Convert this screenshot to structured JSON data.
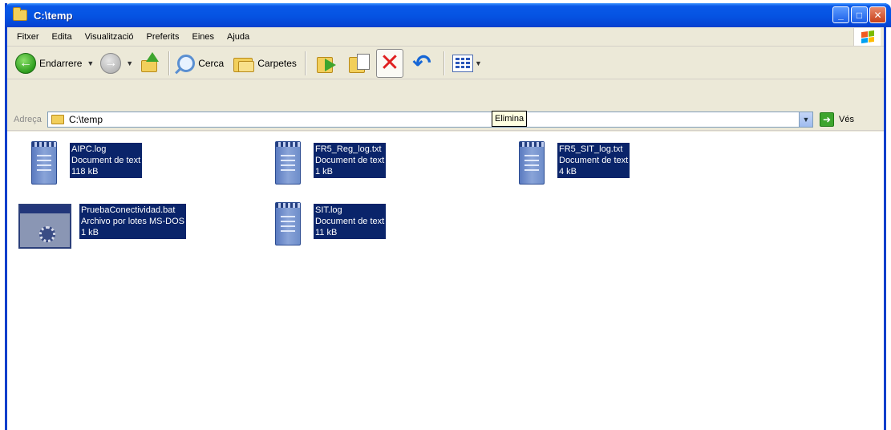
{
  "window": {
    "title": "C:\\temp"
  },
  "title_buttons": {
    "minimize": "_",
    "maximize": "□",
    "close": "✕"
  },
  "menu": {
    "items": [
      "Fitxer",
      "Edita",
      "Visualització",
      "Preferits",
      "Eines",
      "Ajuda"
    ]
  },
  "toolbar": {
    "back_label": "Endarrere",
    "search_label": "Cerca",
    "folders_label": "Carpetes"
  },
  "tooltip": {
    "text": "Elimina"
  },
  "address": {
    "label": "Adreça",
    "value": "C:\\temp",
    "go_label": "Vés"
  },
  "files": [
    {
      "name": "AIPC.log",
      "type": "Document de text",
      "size": "118 kB",
      "icon": "text-document-icon"
    },
    {
      "name": "FR5_Reg_log.txt",
      "type": "Document de text",
      "size": "1 kB",
      "icon": "text-document-icon"
    },
    {
      "name": "FR5_SIT_log.txt",
      "type": "Document de text",
      "size": "4 kB",
      "icon": "text-document-icon"
    },
    {
      "name": "PruebaConectividad.bat",
      "type": "Archivo por lotes MS-DOS",
      "size": "1 kB",
      "icon": "batch-file-icon"
    },
    {
      "name": "SIT.log",
      "type": "Document de text",
      "size": "11 kB",
      "icon": "text-document-icon"
    }
  ],
  "colors": {
    "titlebar": "#0554e3",
    "selection": "#0a246a",
    "chrome": "#ece9d8"
  }
}
